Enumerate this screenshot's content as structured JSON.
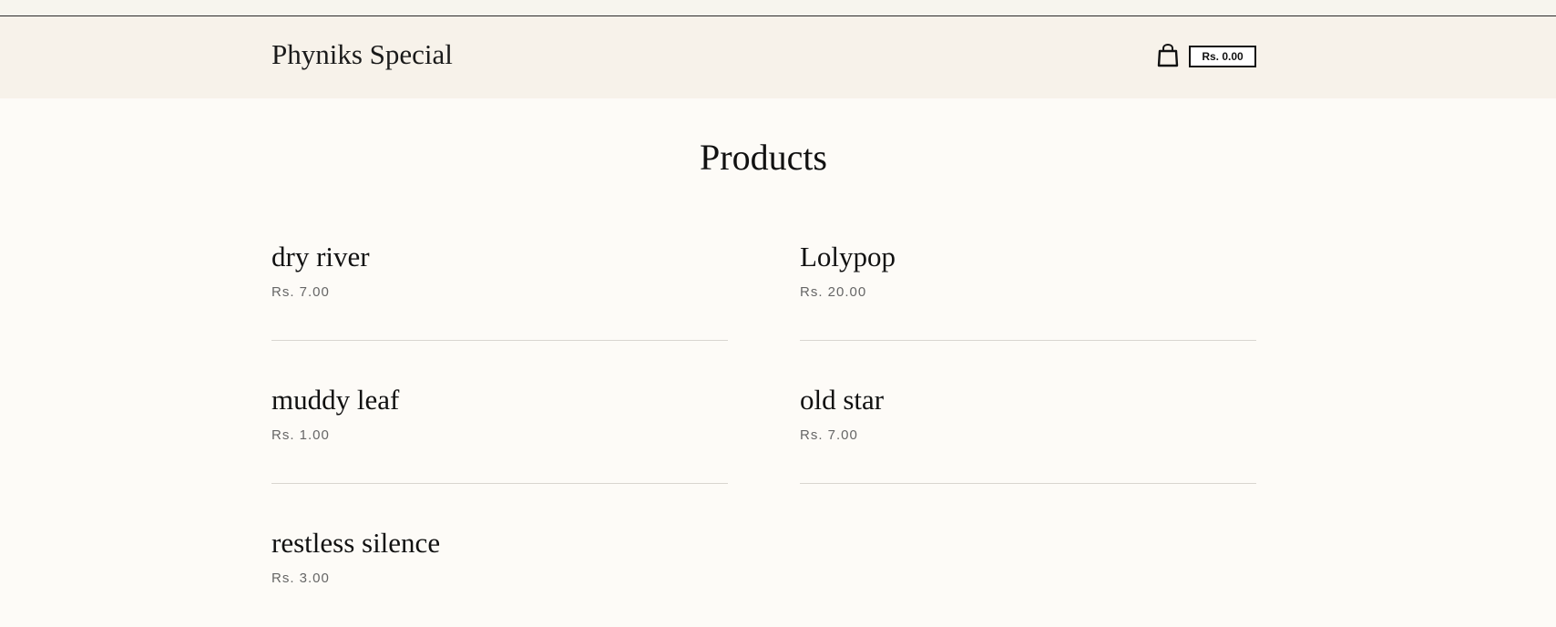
{
  "header": {
    "brand": "Phyniks Special",
    "cart_icon": "shopping-bag-icon",
    "cart_total": "Rs. 0.00"
  },
  "main": {
    "title": "Products",
    "products": [
      {
        "name": "dry river",
        "price": "Rs. 7.00"
      },
      {
        "name": "Lolypop",
        "price": "Rs. 20.00"
      },
      {
        "name": "muddy leaf",
        "price": "Rs. 1.00"
      },
      {
        "name": "old star",
        "price": "Rs. 7.00"
      },
      {
        "name": "restless silence",
        "price": "Rs. 3.00"
      }
    ]
  },
  "colors": {
    "header_background": "#f7f2ea",
    "page_background": "#fdfbf7",
    "price_text": "#666666",
    "divider": "#d9d6d0"
  }
}
